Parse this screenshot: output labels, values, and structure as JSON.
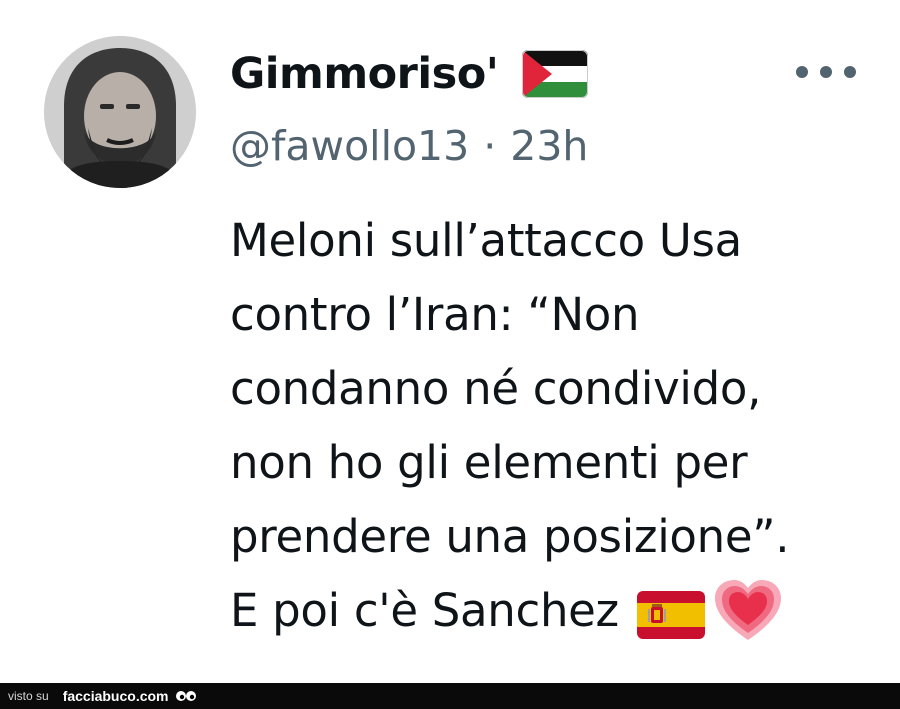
{
  "tweet": {
    "author": {
      "display_name": "Gimmoriso'",
      "handle": "@fawollo13",
      "flag_icon": "palestine-flag-icon"
    },
    "separator": "·",
    "time_ago": "23h",
    "more_icon": "more-options-icon",
    "body_lines": [
      "Meloni sull’attacco Usa",
      "contro l’Iran: “Non",
      "condanno né condivido,",
      "non ho gli elementi per",
      "prendere una posizione”.",
      "E poi c'è Sanchez"
    ],
    "trailing_emojis": [
      "spain-flag-icon",
      "heart-icon"
    ]
  },
  "footer": {
    "visto_label": "visto su",
    "site_label": "facciabuco.com"
  },
  "colors": {
    "text_primary": "#0f1419",
    "text_secondary": "#536471",
    "footer_bg": "#0a0a0a"
  }
}
